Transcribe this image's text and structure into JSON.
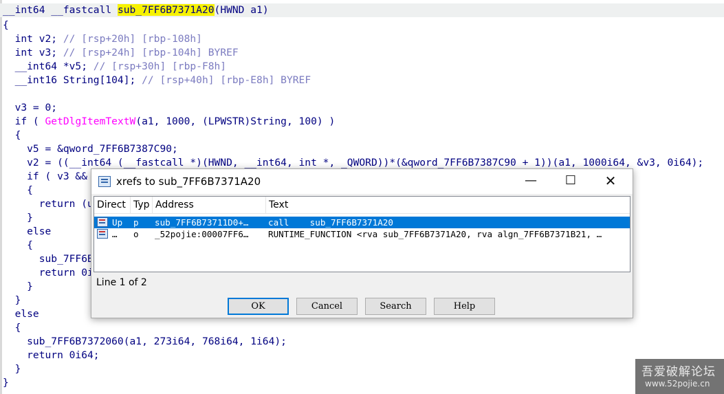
{
  "code": {
    "header_prefix": "__int64 __fastcall ",
    "header_func": "sub_7FF6B7371A20",
    "header_suffix": "(HWND a1)",
    "lines": [
      "{",
      "  int v2; // [rsp+20h] [rbp-108h]",
      "  int v3; // [rsp+24h] [rbp-104h] BYREF",
      "  __int64 *v5; // [rsp+30h] [rbp-F8h]",
      "  __int16 String[104]; // [rsp+40h] [rbp-E8h] BYREF",
      "",
      "  v3 = 0;",
      "  if ( GetDlgItemTextW(a1, 1000, (LPWSTR)String, 100) )",
      "  {",
      "    v5 = &qword_7FF6B7387C90;",
      "    v2 = ((__int64 (__fastcall *)(HWND, __int64, int *, _QWORD))*(&qword_7FF6B7387C90 + 1))(a1, 1000i64, &v3, 0i64);",
      "    if ( v3 &&",
      "    {",
      "      return (u",
      "    }",
      "    else",
      "    {",
      "      sub_7FF6B",
      "      return 0i",
      "    }",
      "  }",
      "  else",
      "  {",
      "    sub_7FF6B7372060(a1, 273i64, 768i64, 1i64);",
      "    return 0i64;",
      "  }",
      "}"
    ]
  },
  "dialog": {
    "title": "xrefs to sub_7FF6B7371A20",
    "window_buttons": {
      "minimize": "—",
      "maximize": "☐",
      "close": "✕"
    },
    "columns": [
      "Direct",
      "Typ",
      "Address",
      "Text"
    ],
    "rows": [
      {
        "direction": "Up",
        "type": "p",
        "address": "sub_7FF6B73711D0+…",
        "text": "call    sub_7FF6B7371A20",
        "selected": true
      },
      {
        "direction": "…",
        "type": "o",
        "address": "_52pojie:00007FF6…",
        "text": "RUNTIME_FUNCTION <rva sub_7FF6B7371A20, rva algn_7FF6B7371B21, …",
        "selected": false
      }
    ],
    "status": "Line 1 of 2",
    "buttons": {
      "ok": "OK",
      "cancel": "Cancel",
      "search": "Search",
      "help": "Help"
    }
  },
  "watermark": {
    "name": "吾爱破解论坛",
    "url": "www.52pojie.cn"
  }
}
